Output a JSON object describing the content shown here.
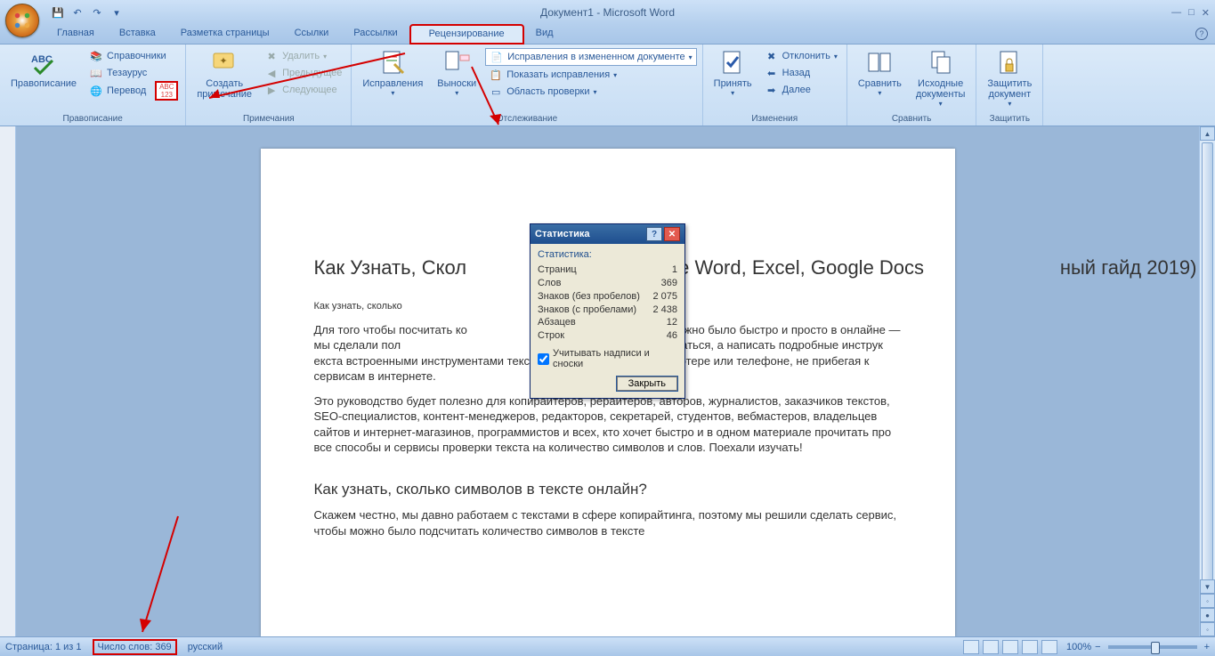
{
  "title": "Документ1 - Microsoft Word",
  "tabs": {
    "home": "Главная",
    "insert": "Вставка",
    "layout": "Разметка страницы",
    "refs": "Ссылки",
    "mail": "Рассылки",
    "review": "Рецензирование",
    "view": "Вид"
  },
  "ribbon": {
    "proofing": {
      "label": "Правописание",
      "spell": "Правописание",
      "refs": "Справочники",
      "thes": "Тезаурус",
      "trans": "Перевод"
    },
    "comments": {
      "label": "Примечания",
      "new": "Создать\nпримечание",
      "del": "Удалить",
      "prev": "Предыдущее",
      "next": "Следующее"
    },
    "tracking": {
      "label": "Отслеживание",
      "track": "Исправления",
      "balloons": "Выноски",
      "display": "Исправления в измененном документе",
      "show": "Показать исправления",
      "pane": "Область проверки"
    },
    "changes": {
      "label": "Изменения",
      "accept": "Принять",
      "reject": "Отклонить",
      "prev": "Назад",
      "next": "Далее"
    },
    "compare": {
      "label": "Сравнить",
      "compare": "Сравнить",
      "sources": "Исходные\nдокументы"
    },
    "protect": {
      "label": "Защитить",
      "protect": "Защитить\nдокумент"
    }
  },
  "doc": {
    "h1": "Как Узнать, Скол                           в Тексте Word, Excel, Google Docs                         ный гайд 2019)",
    "h2a": "Как узнать, сколько",
    "h2a_end": "?",
    "p1": "Для того чтобы посчитать ко                                                     ексте можно было быстро и просто в онлайне — мы сделали пол                                              и решили не останавливаться, а написать подробные инструк                                                  екста встроенными инструментами текстовых редакторов на компьютере или телефоне, не прибегая к сервисам в интернете.",
    "p2": "Это руководство будет полезно для копирайтеров, рерайтеров, авторов, журналистов, заказчиков текстов, SEO-специалистов, контент-менеджеров, редакторов, секретарей, студентов, вебмастеров, владельцев сайтов и интернет-магазинов, программистов и всех, кто хочет быстро и в одном материале прочитать про все способы и сервисы проверки текста на количество символов и слов. Поехали изучать!",
    "h2b": "Как узнать, сколько символов в тексте онлайн?",
    "p3": "Скажем честно, мы давно работаем с текстами в сфере копирайтинга, поэтому мы решили сделать сервис, чтобы можно было подсчитать количество символов в тексте"
  },
  "dialog": {
    "title": "Статистика",
    "header": "Статистика:",
    "rows": {
      "pages_l": "Страниц",
      "pages_v": "1",
      "words_l": "Слов",
      "words_v": "369",
      "chars_l": "Знаков (без пробелов)",
      "chars_v": "2 075",
      "charsp_l": "Знаков (с пробелами)",
      "charsp_v": "2 438",
      "para_l": "Абзацев",
      "para_v": "12",
      "lines_l": "Строк",
      "lines_v": "46"
    },
    "check": "Учитывать надписи и сноски",
    "close": "Закрыть"
  },
  "status": {
    "page": "Страница: 1 из 1",
    "words": "Число слов: 369",
    "lang": "русский",
    "zoom": "100%"
  }
}
